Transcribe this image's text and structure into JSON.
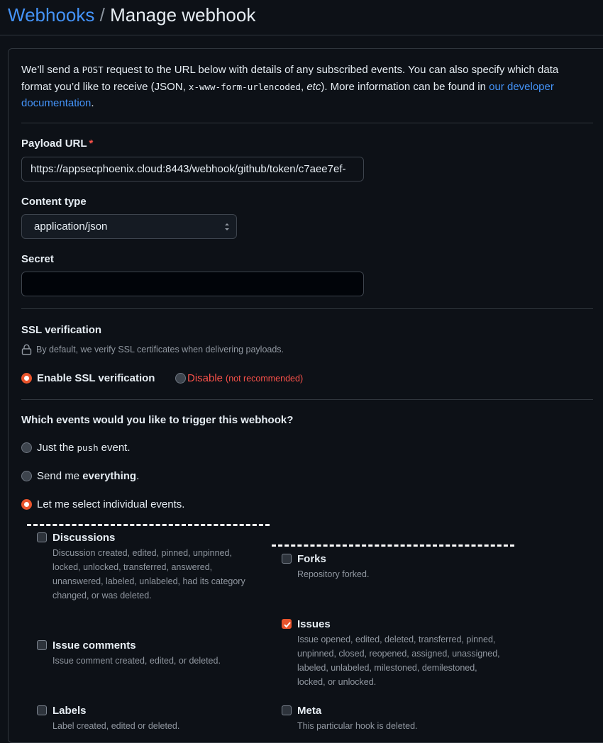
{
  "header": {
    "breadcrumb_link": "Webhooks",
    "separator": "/",
    "title": "Manage webhook"
  },
  "intro": {
    "part1": "We’ll send a ",
    "code1": "POST",
    "part2": " request to the URL below with details of any subscribed events. You can also specify which data format you’d like to receive (JSON, ",
    "code2": "x-www-form-urlencoded",
    "part3": ", ",
    "etc": "etc",
    "part4": "). More information can be found in ",
    "link": "our developer documentation",
    "part5": "."
  },
  "payload_url": {
    "label": "Payload URL",
    "required_mark": "*",
    "value": "https://appsecphoenix.cloud:8443/webhook/github/token/c7aee7ef-"
  },
  "content_type": {
    "label": "Content type",
    "selected": "application/json"
  },
  "secret": {
    "label": "Secret",
    "value": ""
  },
  "ssl": {
    "label": "SSL verification",
    "note": "By default, we verify SSL certificates when delivering payloads.",
    "enable_label": "Enable SSL verification",
    "disable_label": "Disable",
    "disable_note": "(not recommended)",
    "selected": "enable"
  },
  "events": {
    "question": "Which events would you like to trigger this webhook?",
    "opt_push_before": "Just the",
    "opt_push_code": "push",
    "opt_push_after": "event.",
    "opt_all_before": "Send me",
    "opt_all_bold": "everything",
    "opt_all_after": ".",
    "opt_select": "Let me select individual events.",
    "selected": "individual",
    "items": [
      {
        "name": "Discussions",
        "desc": "Discussion created, edited, pinned, unpinned, locked, unlocked, transferred, answered, unanswered, labeled, unlabeled, had its category changed, or was deleted.",
        "checked": false
      },
      {
        "name": "Forks",
        "desc": "Repository forked.",
        "checked": false
      },
      {
        "name": "Issues",
        "desc": "Issue opened, edited, deleted, transferred, pinned, unpinned, closed, reopened, assigned, unassigned, labeled, unlabeled, milestoned, demilestoned, locked, or unlocked.",
        "checked": true
      },
      {
        "name": "Issue comments",
        "desc": "Issue comment created, edited, or deleted.",
        "checked": false
      },
      {
        "name": "Labels",
        "desc": "Label created, edited or deleted.",
        "checked": false
      },
      {
        "name": "Meta",
        "desc": "This particular hook is deleted.",
        "checked": false
      }
    ]
  },
  "colors": {
    "accent": "#e8542c",
    "link": "#4493f8",
    "danger": "#f85149",
    "background": "#0d1117"
  }
}
